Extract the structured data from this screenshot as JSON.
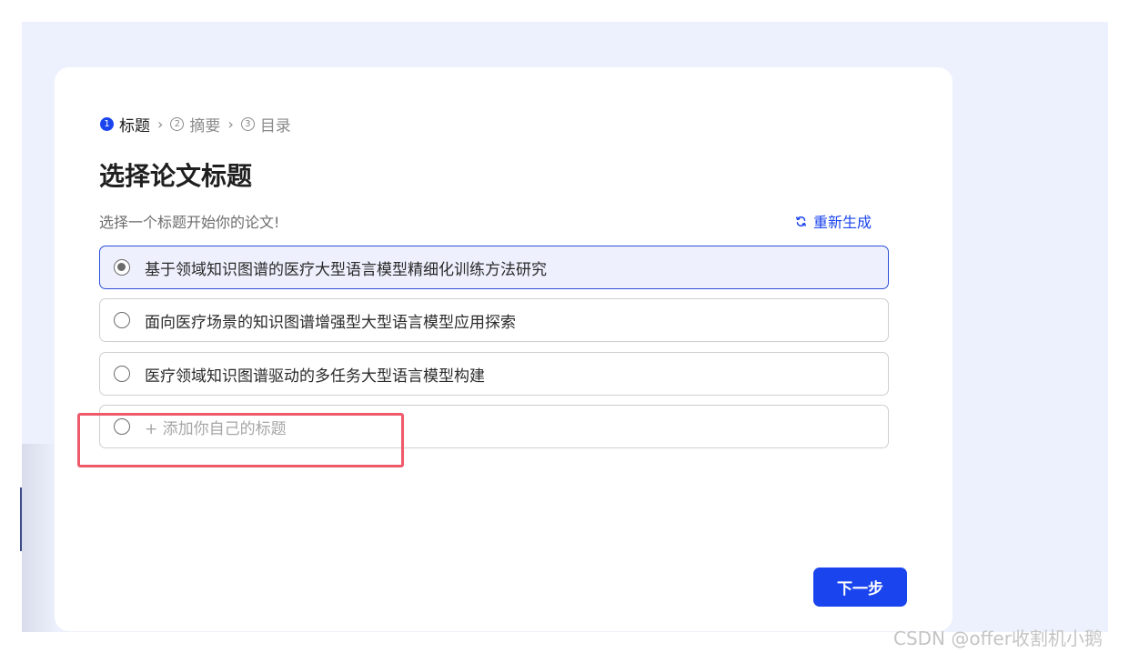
{
  "steps": [
    {
      "num": "1",
      "label": "标题",
      "active": true
    },
    {
      "num": "2",
      "label": "摘要",
      "active": false
    },
    {
      "num": "3",
      "label": "目录",
      "active": false
    }
  ],
  "page_title": "选择论文标题",
  "subtitle": "选择一个标题开始你的论文!",
  "regenerate_label": "重新生成",
  "options": [
    {
      "text": "基于领域知识图谱的医疗大型语言模型精细化训练方法研究",
      "selected": true
    },
    {
      "text": "面向医疗场景的知识图谱增强型大型语言模型应用探索",
      "selected": false
    },
    {
      "text": "医疗领域知识图谱驱动的多任务大型语言模型构建",
      "selected": false
    }
  ],
  "add_option_placeholder": "+ 添加你自己的标题",
  "next_button_label": "下一步",
  "watermark": "CSDN @offer收割机小鹅",
  "colors": {
    "accent": "#1a44ee",
    "background": "#edf1fd",
    "selected_bg": "#eef1fd",
    "highlight": "#ef5a6b"
  }
}
